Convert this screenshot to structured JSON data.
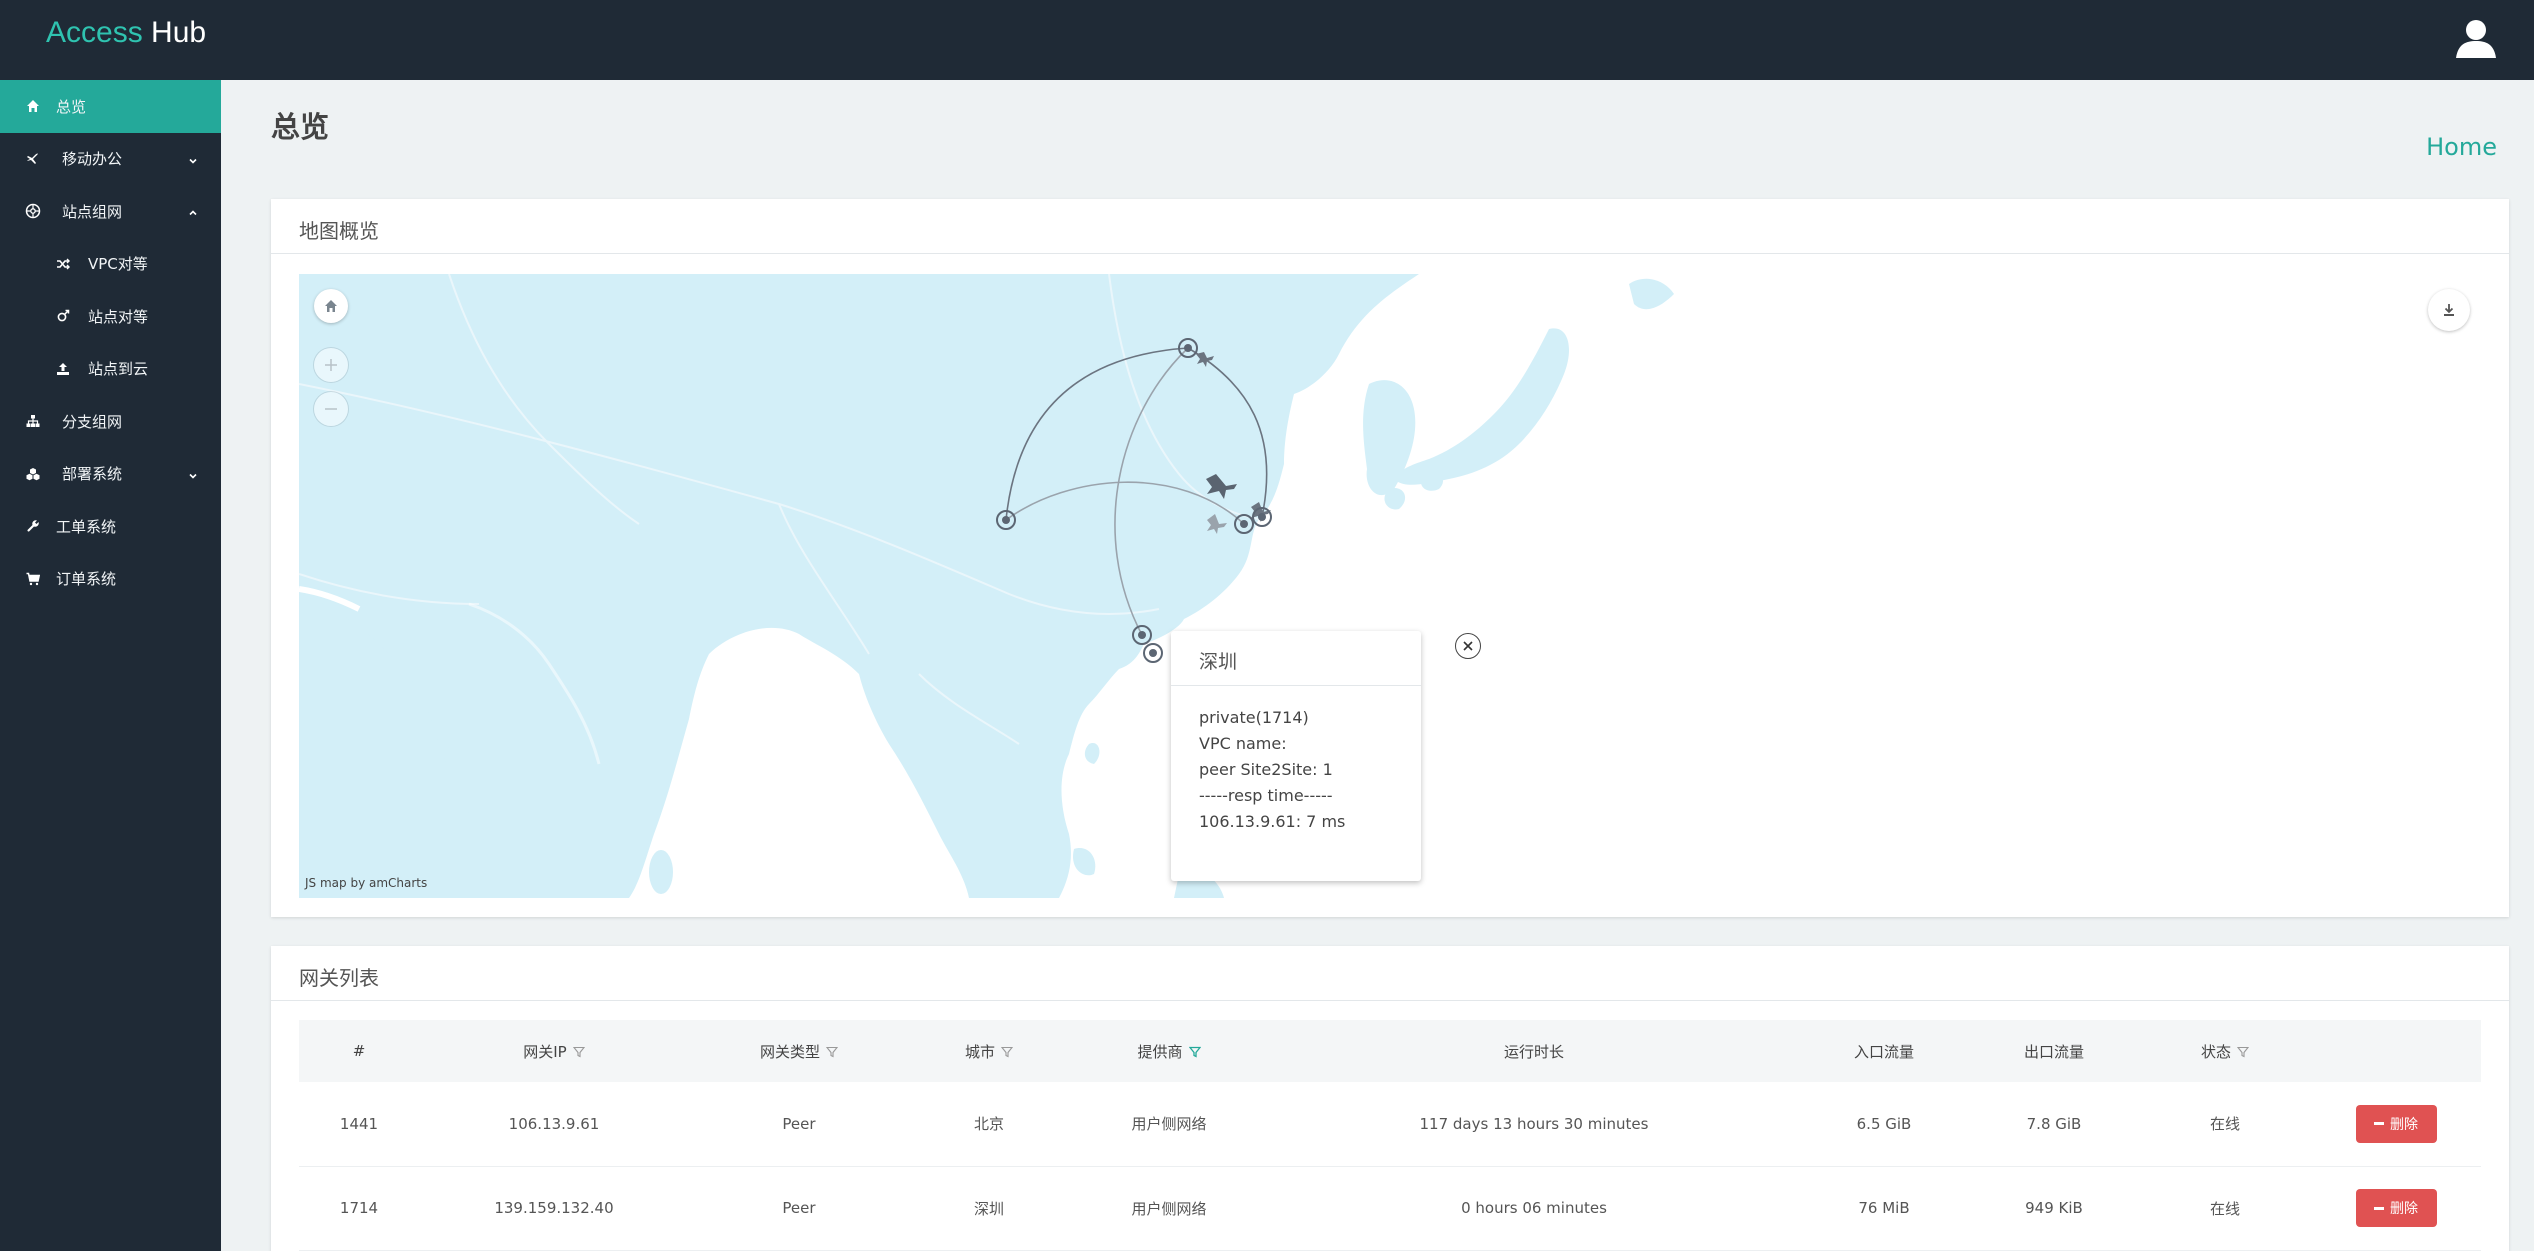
{
  "app": {
    "brand_part1": "Access",
    "brand_part2": "Hub"
  },
  "sidebar": {
    "items": [
      {
        "label": "总览",
        "icon": "home-icon",
        "active": true
      },
      {
        "label": "移动办公",
        "icon": "plane-icon",
        "expandable": true,
        "expanded": false
      },
      {
        "label": "站点组网",
        "icon": "network-icon",
        "expandable": true,
        "expanded": true
      },
      {
        "label": "VPC对等",
        "icon": "shuffle-icon",
        "sub": true
      },
      {
        "label": "站点对等",
        "icon": "venus-icon",
        "sub": true
      },
      {
        "label": "站点到云",
        "icon": "upload-icon",
        "sub": true
      },
      {
        "label": "分支组网",
        "icon": "sitemap-icon"
      },
      {
        "label": "部署系统",
        "icon": "cubes-icon",
        "expandable": true,
        "expanded": false
      },
      {
        "label": "工单系统",
        "icon": "wrench-icon"
      },
      {
        "label": "订单系统",
        "icon": "cart-icon"
      }
    ]
  },
  "page": {
    "title": "总览",
    "breadcrumb": "Home"
  },
  "map_card": {
    "title": "地图概览",
    "credit": "JS map by amCharts",
    "popup": {
      "title": "深圳",
      "lines": [
        "private(1714)",
        "VPC name:",
        "peer Site2Site: 1",
        "-----resp time-----",
        "106.13.9.61: 7 ms"
      ]
    }
  },
  "gateway_card": {
    "title": "网关列表",
    "columns": [
      "#",
      "网关IP",
      "网关类型",
      "城市",
      "提供商",
      "运行时长",
      "入口流量",
      "出口流量",
      "状态",
      ""
    ],
    "filter_columns": [
      1,
      2,
      3,
      4,
      8
    ],
    "active_filter_column": 4,
    "rows": [
      [
        "1441",
        "106.13.9.61",
        "Peer",
        "北京",
        "用户侧网络",
        "117 days 13 hours 30 minutes",
        "6.5 GiB",
        "7.8 GiB",
        "在线"
      ],
      [
        "1714",
        "139.159.132.40",
        "Peer",
        "深圳",
        "用户侧网络",
        "0 hours 06 minutes",
        "76 MiB",
        "949 KiB",
        "在线"
      ]
    ],
    "delete_label": "删除"
  },
  "colors": {
    "accent": "#24a99a",
    "header_bg": "#1f2a36",
    "danger": "#e05252",
    "map_water": "#d3eff8"
  }
}
